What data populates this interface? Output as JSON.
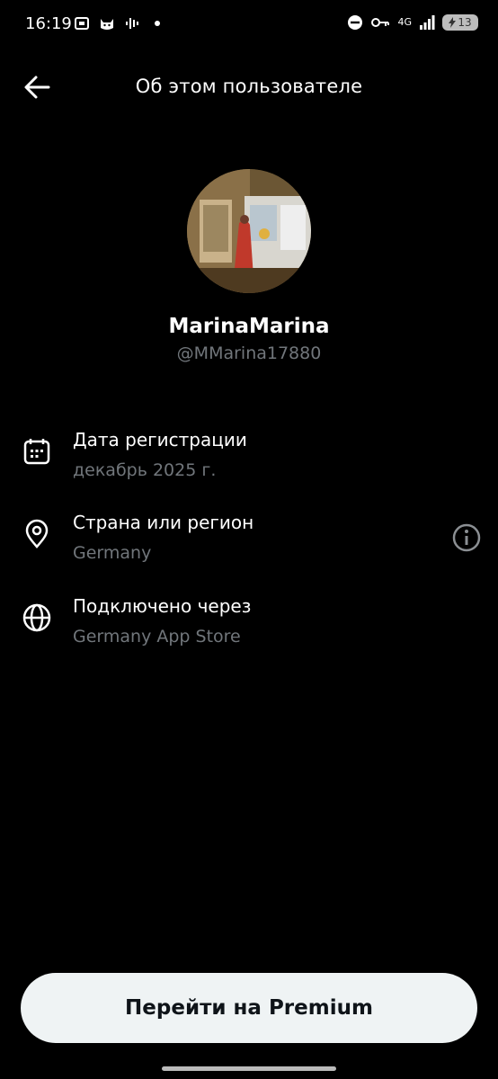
{
  "status_bar": {
    "time": "16:19",
    "network": "4G",
    "battery": "13"
  },
  "header": {
    "title": "Об этом пользователе"
  },
  "profile": {
    "display_name": "MarinaMarina",
    "handle": "@MMarina17880"
  },
  "info": {
    "joined_label": "Дата регистрации",
    "joined_value": "декабрь 2025 г.",
    "country_label": "Страна или регион",
    "country_value": "Germany",
    "connected_label": "Подключено через",
    "connected_value": "Germany App Store"
  },
  "actions": {
    "premium_label": "Перейти на Premium"
  },
  "colors": {
    "background": "#000000",
    "secondary_text": "#71767b",
    "button_bg": "#eff3f4"
  }
}
